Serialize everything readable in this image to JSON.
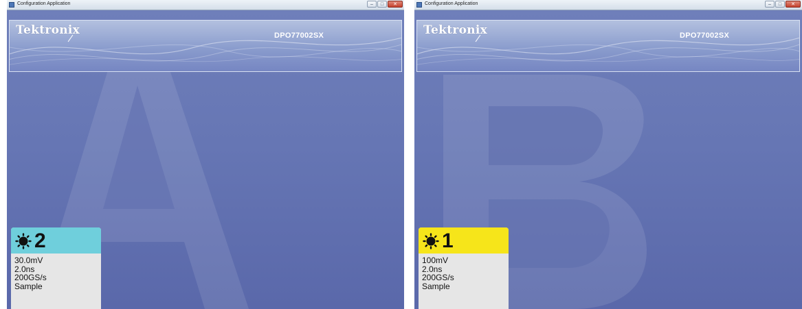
{
  "windows": [
    {
      "title": "Configuration Application",
      "brand": "Tektronix",
      "model": "DPO77002SX",
      "watermark_letter": "A",
      "channel": {
        "number": "2",
        "color": "#6fcfdc",
        "vertical_scale": "30.0mV",
        "timebase": "2.0ns",
        "sample_rate": "200GS/s",
        "acquisition_mode": "Sample"
      }
    },
    {
      "title": "Configuration Application",
      "brand": "Tektronix",
      "model": "DPO77002SX",
      "watermark_letter": "B",
      "channel": {
        "number": "1",
        "color": "#f6e51a",
        "vertical_scale": "100mV",
        "timebase": "2.0ns",
        "sample_rate": "200GS/s",
        "acquisition_mode": "Sample"
      }
    }
  ],
  "window_controls": {
    "minimize": "–",
    "maximize": "□",
    "close": "✕"
  }
}
